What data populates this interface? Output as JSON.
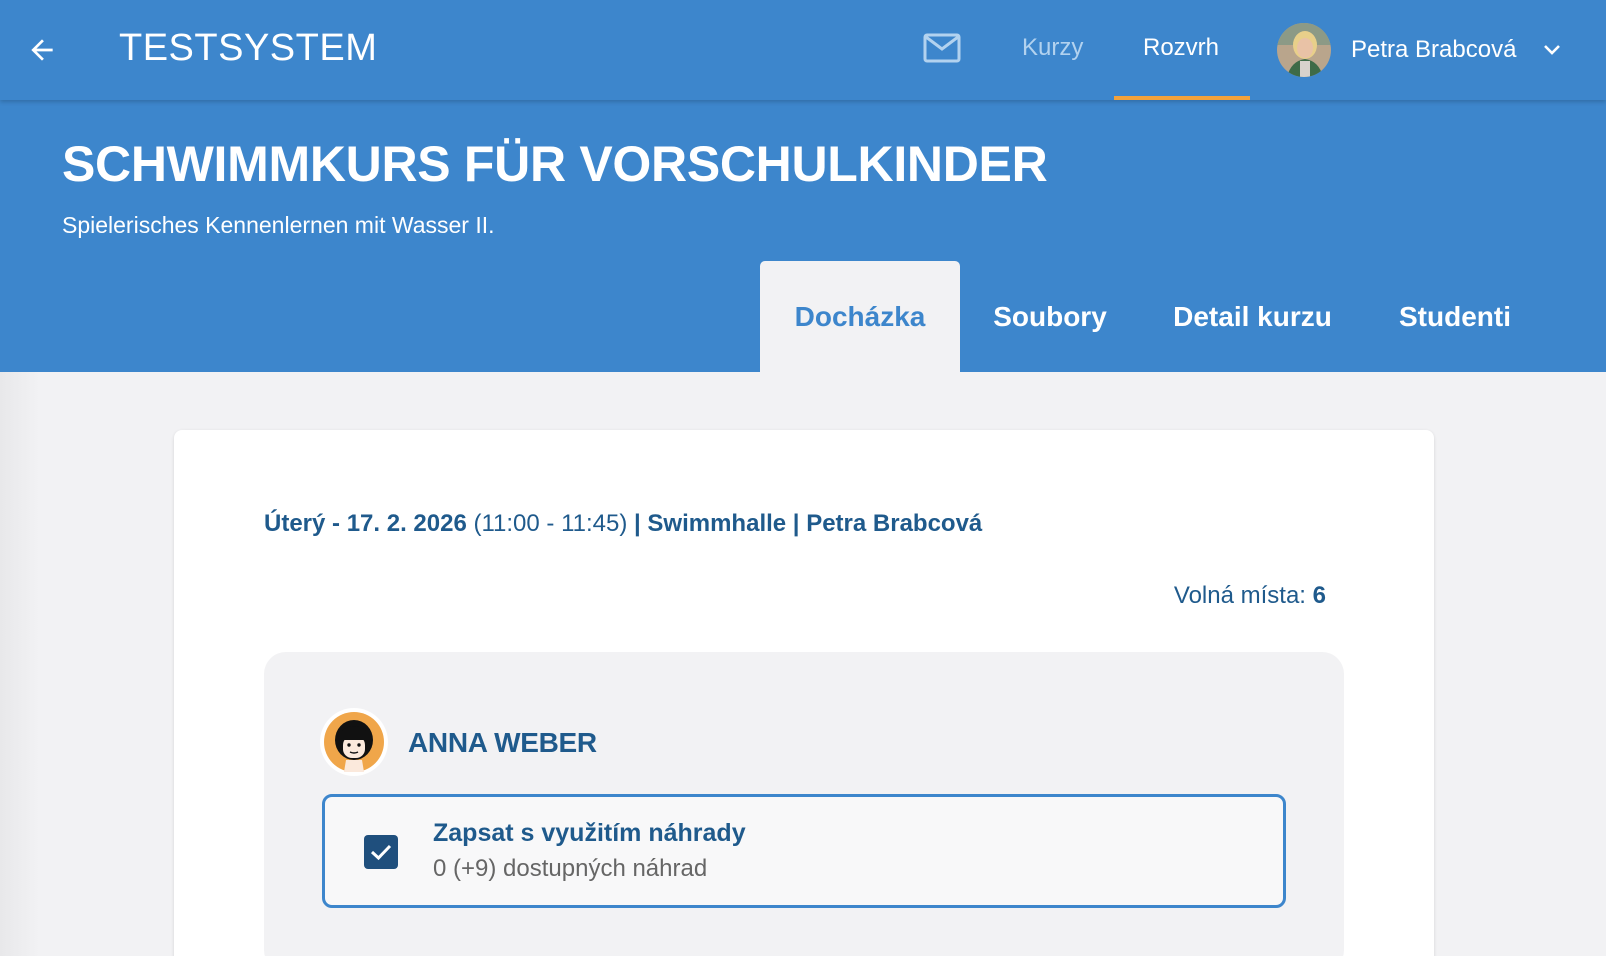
{
  "appbar": {
    "title": "TESTSYSTEM",
    "nav": [
      {
        "label": "Kurzy",
        "active": false
      },
      {
        "label": "Rozvrh",
        "active": true
      }
    ],
    "user_name": "Petra Brabcová",
    "icons": {
      "back": "arrow-left-icon",
      "mail": "mail-icon",
      "dropdown": "chevron-down-icon"
    }
  },
  "course": {
    "title": "SCHWIMMKURS FÜR VORSCHULKINDER",
    "subtitle": "Spielerisches Kennenlernen mit Wasser II.",
    "tabs": [
      {
        "label": "Docházka",
        "active": true
      },
      {
        "label": "Soubory",
        "active": false
      },
      {
        "label": "Detail kurzu",
        "active": false
      },
      {
        "label": "Studenti",
        "active": false
      }
    ]
  },
  "lesson": {
    "date": "Úterý - 17. 2. 2026",
    "time": "(11:00 - 11:45)",
    "separator": "|",
    "location": "Swimmhalle",
    "instructor": "Petra Brabcová",
    "free_spots_label": "Volná místa:",
    "free_spots_value": "6"
  },
  "student": {
    "name": "ANNA WEBER",
    "option": {
      "title": "Zapsat s využitím náhrady",
      "subtitle": "0 (+9) dostupných náhrad",
      "checked": true
    }
  },
  "colors": {
    "primary": "#3d86cc",
    "accent": "#f3a23b",
    "dark_text": "#1f5a8c",
    "background": "#f2f2f4"
  }
}
